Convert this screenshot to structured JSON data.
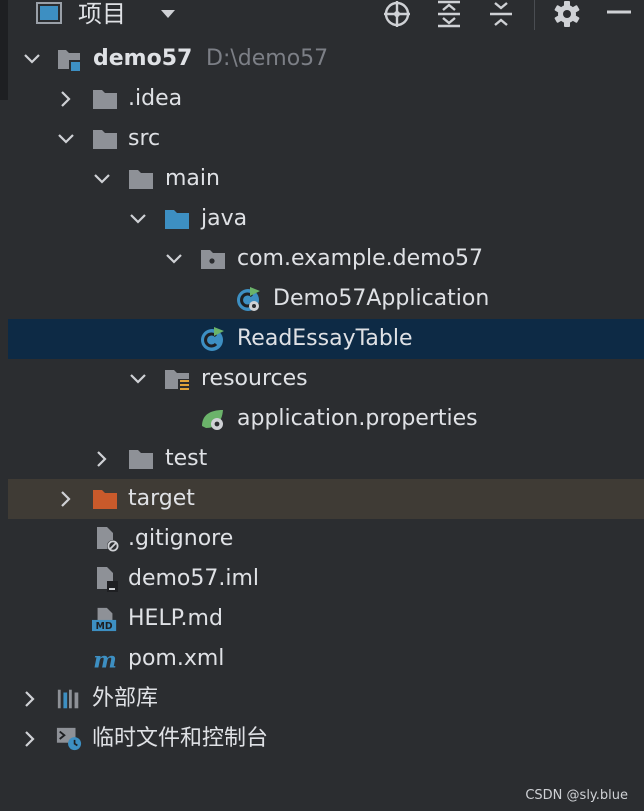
{
  "header": {
    "title": "项目",
    "icons": [
      "project-view-icon",
      "dropdown-icon",
      "locate-icon",
      "expand-all-icon",
      "collapse-all-icon",
      "gear-icon",
      "minimize-icon"
    ]
  },
  "tree": {
    "project_name": "demo57",
    "project_path": "D:\\demo57",
    "idea": ".idea",
    "src": "src",
    "main": "main",
    "java": "java",
    "package": "com.example.demo57",
    "app_class": "Demo57Application",
    "selected_class": "ReadEssayTable",
    "resources": "resources",
    "properties": "application.properties",
    "test": "test",
    "target": "target",
    "gitignore": ".gitignore",
    "iml": "demo57.iml",
    "help": "HELP.md",
    "pom": "pom.xml",
    "external_libs": "外部库",
    "scratches": "临时文件和控制台"
  },
  "watermark": "CSDN @sly.blue",
  "colors": {
    "folder": "#8e9197",
    "source_folder": "#3d8fc2",
    "target_folder": "#c95a2b",
    "selection": "#0d2a45",
    "spring": "#6bb36a"
  }
}
